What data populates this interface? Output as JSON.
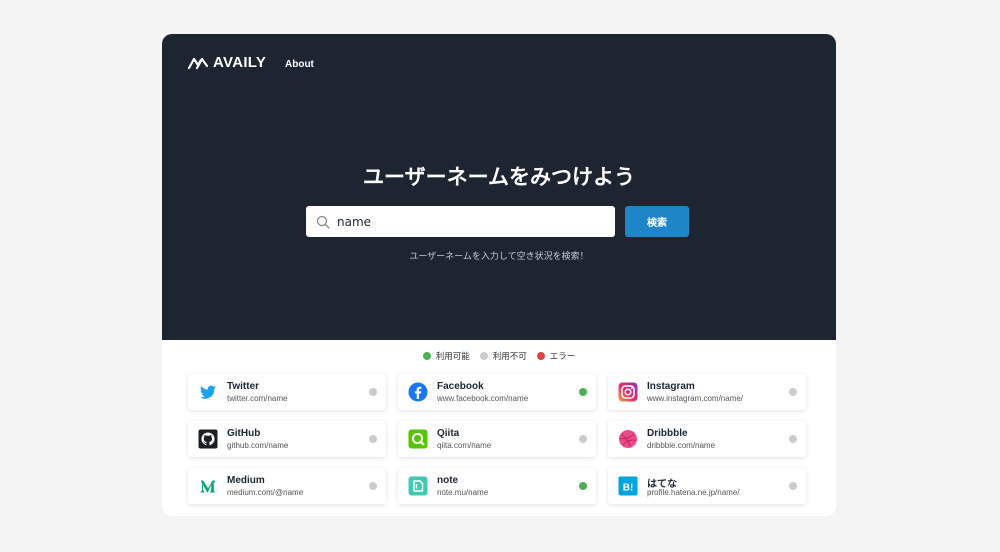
{
  "header": {
    "logo_text": "AVAILY",
    "nav_about": "About"
  },
  "hero": {
    "title": "ユーザーネームをみつけよう",
    "search_value": "name",
    "search_button": "検索",
    "hint": "ユーザーネームを入力して空き状況を検索！"
  },
  "colors": {
    "hero_bg": "#1c2530",
    "accent": "#1e86c8",
    "available": "#4caf50",
    "unavailable": "#cccccc",
    "error": "#e0443e"
  },
  "legend": {
    "available": "利用可能",
    "unavailable": "利用不可",
    "error": "エラー"
  },
  "services": [
    {
      "name": "Twitter",
      "url": "twitter.com/name",
      "icon": "twitter-icon",
      "status": "unavailable"
    },
    {
      "name": "Facebook",
      "url": "www.facebook.com/name",
      "icon": "facebook-icon",
      "status": "available"
    },
    {
      "name": "Instagram",
      "url": "www.instagram.com/name/",
      "icon": "instagram-icon",
      "status": "unavailable"
    },
    {
      "name": "GitHub",
      "url": "github.com/name",
      "icon": "github-icon",
      "status": "unavailable"
    },
    {
      "name": "Qiita",
      "url": "qiita.com/name",
      "icon": "qiita-icon",
      "status": "unavailable"
    },
    {
      "name": "Dribbble",
      "url": "dribbble.com/name",
      "icon": "dribbble-icon",
      "status": "unavailable"
    },
    {
      "name": "Medium",
      "url": "medium.com/@name",
      "icon": "medium-icon",
      "status": "unavailable"
    },
    {
      "name": "note",
      "url": "note.mu/name",
      "icon": "note-icon",
      "status": "available"
    },
    {
      "name": "はてな",
      "url": "profile.hatena.ne.jp/name/",
      "icon": "hatena-icon",
      "status": "unavailable"
    }
  ]
}
